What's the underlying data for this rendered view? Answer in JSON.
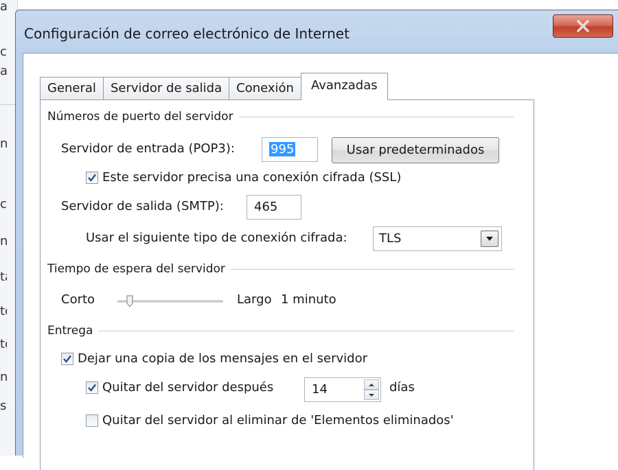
{
  "background": {
    "fragments": [
      "a",
      "ci",
      "a",
      "n",
      "c",
      "n",
      "ta",
      "to",
      "to",
      "n",
      "s"
    ]
  },
  "window": {
    "title": "Configuración de correo electrónico de Internet",
    "close_glyph": "X"
  },
  "tabs": [
    {
      "label": "General"
    },
    {
      "label": "Servidor de salida"
    },
    {
      "label": "Conexión"
    },
    {
      "label": "Avanzadas",
      "active": true
    }
  ],
  "ports": {
    "group_label": "Números de puerto del servidor",
    "incoming_label": "Servidor de entrada (POP3):",
    "incoming_value": "995",
    "defaults_button": "Usar predeterminados",
    "ssl_checkbox": {
      "label": "Este servidor precisa una conexión cifrada (SSL)",
      "checked": true
    },
    "outgoing_label": "Servidor de salida (SMTP):",
    "outgoing_value": "465",
    "encryption_label": "Usar el siguiente tipo de conexión cifrada:",
    "encryption_value": "TLS"
  },
  "timeout": {
    "group_label": "Tiempo de espera del servidor",
    "short_label": "Corto",
    "long_label": "Largo",
    "value_label": "1 minuto",
    "slider_level": 0.12
  },
  "delivery": {
    "group_label": "Entrega",
    "leave_copy": {
      "label": "Dejar una copia de los mensajes en el servidor",
      "checked": true
    },
    "remove_after": {
      "label": "Quitar del servidor después",
      "checked": true
    },
    "days_value": "14",
    "days_label": "días",
    "remove_deleted": {
      "label": "Quitar del servidor al eliminar de 'Elementos eliminados'",
      "checked": false
    }
  },
  "colors": {
    "selection": "#3399ff",
    "close_button": "#c2412b",
    "frame": "#bcd2ec"
  }
}
